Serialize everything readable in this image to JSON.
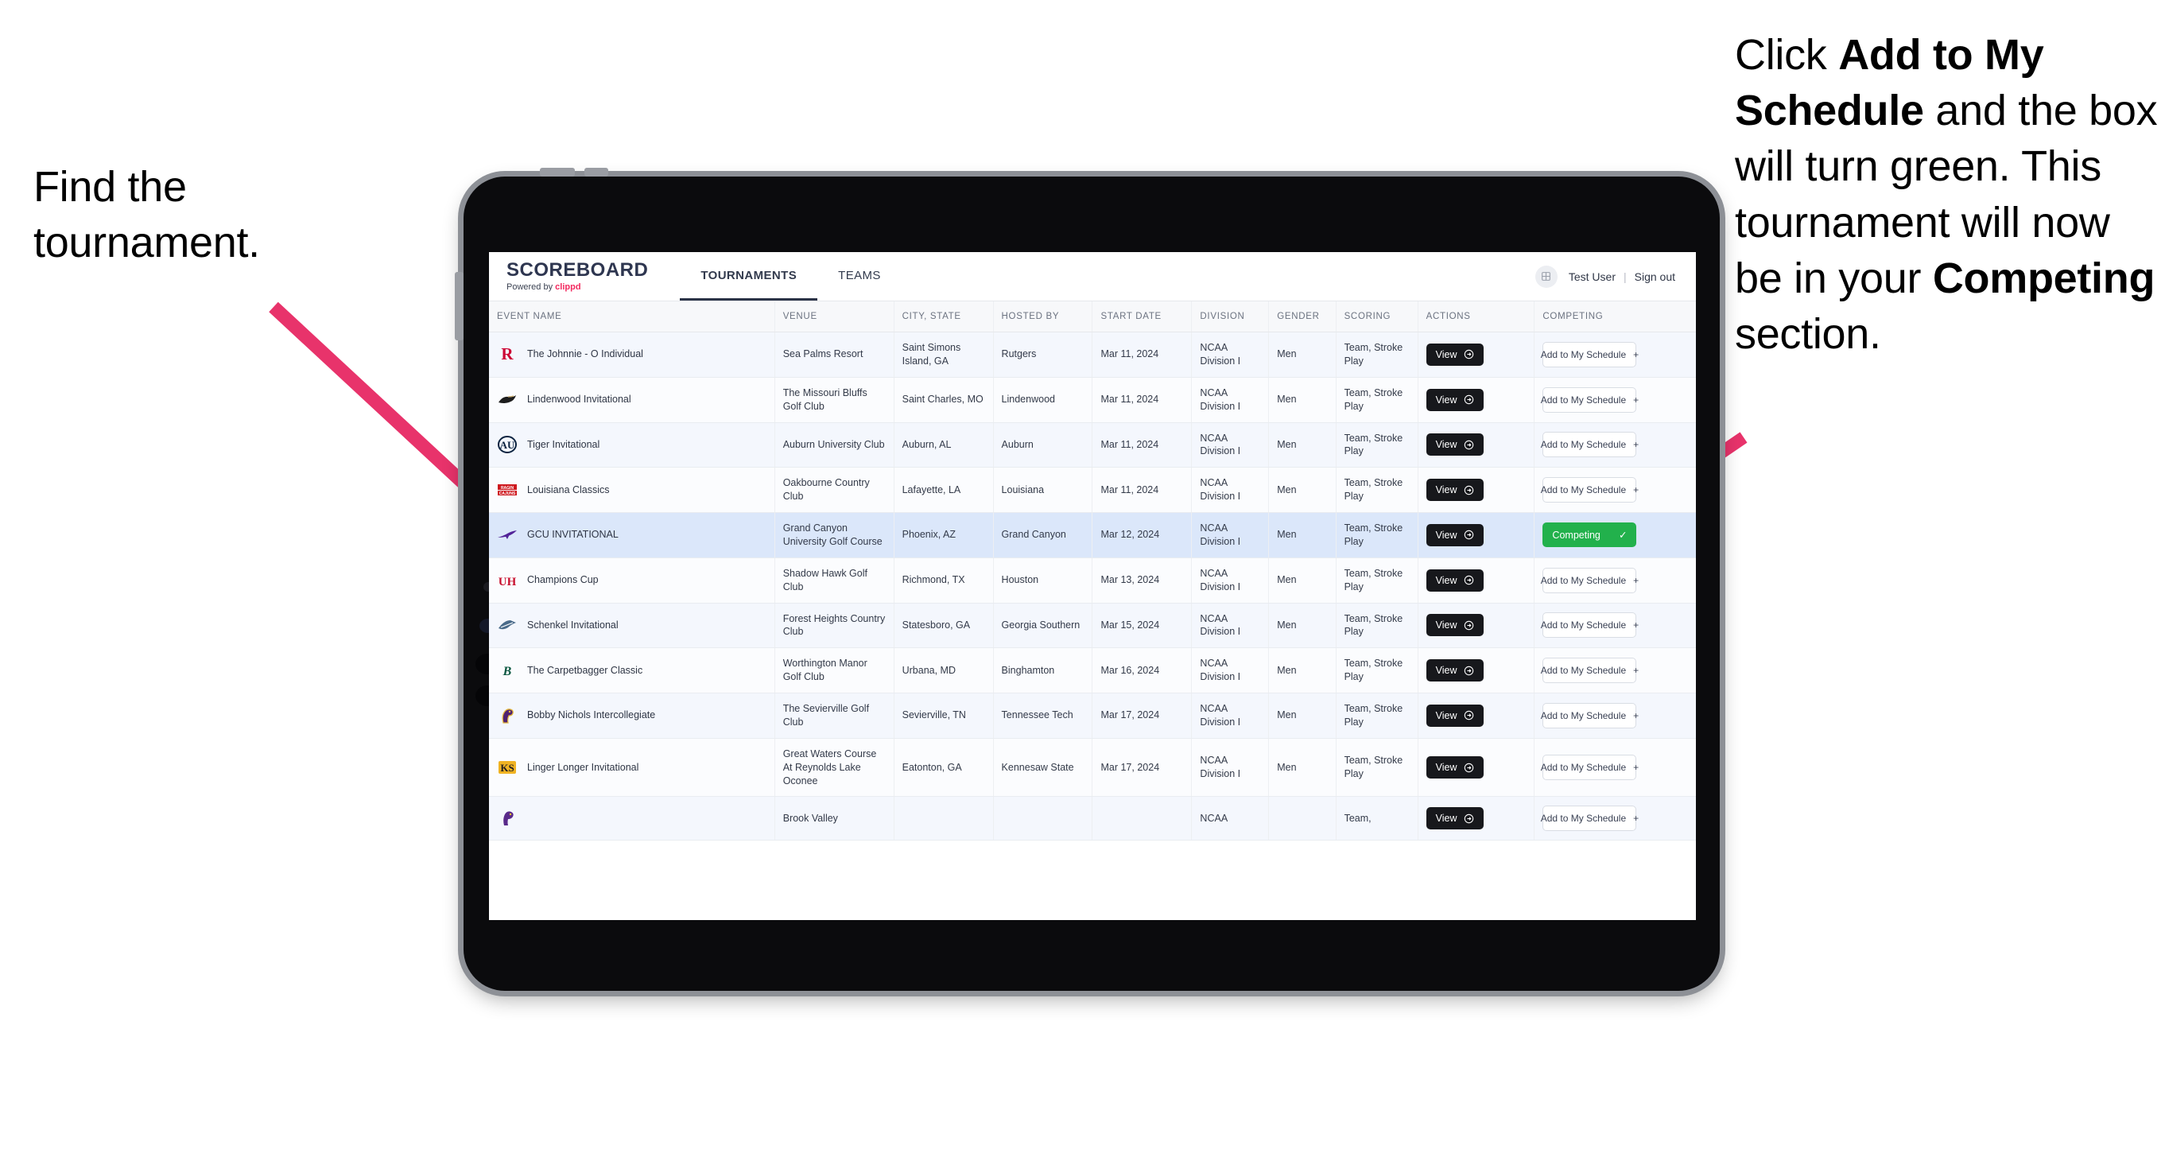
{
  "annotations": {
    "left": {
      "line1": "Find the",
      "line2": "tournament."
    },
    "right": {
      "seg1": "Click ",
      "bold1": "Add to My Schedule",
      "seg2": " and the box will turn green. This tournament will now be in your ",
      "bold2": "Competing",
      "seg3": " section."
    },
    "arrow_color": "#e8336b"
  },
  "app": {
    "brand": {
      "title": "SCOREBOARD",
      "powered_prefix": "Powered by ",
      "powered_name": "clippd"
    },
    "tabs": [
      {
        "label": "TOURNAMENTS",
        "active": true
      },
      {
        "label": "TEAMS",
        "active": false
      }
    ],
    "user": {
      "name": "Test User",
      "separator": "|",
      "sign_out": "Sign out",
      "avatar_icon": "user-avatar-icon"
    }
  },
  "table": {
    "columns": [
      "EVENT NAME",
      "VENUE",
      "CITY, STATE",
      "HOSTED BY",
      "START DATE",
      "DIVISION",
      "GENDER",
      "SCORING",
      "ACTIONS",
      "COMPETING"
    ],
    "labels": {
      "view": "View",
      "add": "Add to My Schedule",
      "competing": "Competing",
      "add_plus": "+",
      "competing_check": "✓"
    },
    "rows": [
      {
        "logo": "rutgers-logo",
        "event": "The Johnnie - O Individual",
        "venue": "Sea Palms Resort",
        "city": "Saint Simons Island, GA",
        "host": "Rutgers",
        "date": "Mar 11, 2024",
        "division": "NCAA Division I",
        "gender": "Men",
        "scoring": "Team, Stroke Play",
        "state": "add"
      },
      {
        "logo": "lindenwood-logo",
        "event": "Lindenwood Invitational",
        "venue": "The Missouri Bluffs Golf Club",
        "city": "Saint Charles, MO",
        "host": "Lindenwood",
        "date": "Mar 11, 2024",
        "division": "NCAA Division I",
        "gender": "Men",
        "scoring": "Team, Stroke Play",
        "state": "add"
      },
      {
        "logo": "auburn-logo",
        "event": "Tiger Invitational",
        "venue": "Auburn University Club",
        "city": "Auburn, AL",
        "host": "Auburn",
        "date": "Mar 11, 2024",
        "division": "NCAA Division I",
        "gender": "Men",
        "scoring": "Team, Stroke Play",
        "state": "add"
      },
      {
        "logo": "louisiana-logo",
        "event": "Louisiana Classics",
        "venue": "Oakbourne Country Club",
        "city": "Lafayette, LA",
        "host": "Louisiana",
        "date": "Mar 11, 2024",
        "division": "NCAA Division I",
        "gender": "Men",
        "scoring": "Team, Stroke Play",
        "state": "add"
      },
      {
        "logo": "gcu-logo",
        "event": "GCU INVITATIONAL",
        "venue": "Grand Canyon University Golf Course",
        "city": "Phoenix, AZ",
        "host": "Grand Canyon",
        "date": "Mar 12, 2024",
        "division": "NCAA Division I",
        "gender": "Men",
        "scoring": "Team, Stroke Play",
        "state": "competing",
        "highlight": true
      },
      {
        "logo": "houston-logo",
        "event": "Champions Cup",
        "venue": "Shadow Hawk Golf Club",
        "city": "Richmond, TX",
        "host": "Houston",
        "date": "Mar 13, 2024",
        "division": "NCAA Division I",
        "gender": "Men",
        "scoring": "Team, Stroke Play",
        "state": "add"
      },
      {
        "logo": "georgia-southern-logo",
        "event": "Schenkel Invitational",
        "venue": "Forest Heights Country Club",
        "city": "Statesboro, GA",
        "host": "Georgia Southern",
        "date": "Mar 15, 2024",
        "division": "NCAA Division I",
        "gender": "Men",
        "scoring": "Team, Stroke Play",
        "state": "add"
      },
      {
        "logo": "binghamton-logo",
        "event": "The Carpetbagger Classic",
        "venue": "Worthington Manor Golf Club",
        "city": "Urbana, MD",
        "host": "Binghamton",
        "date": "Mar 16, 2024",
        "division": "NCAA Division I",
        "gender": "Men",
        "scoring": "Team, Stroke Play",
        "state": "add"
      },
      {
        "logo": "tennessee-tech-logo",
        "event": "Bobby Nichols Intercollegiate",
        "venue": "The Sevierville Golf Club",
        "city": "Sevierville, TN",
        "host": "Tennessee Tech",
        "date": "Mar 17, 2024",
        "division": "NCAA Division I",
        "gender": "Men",
        "scoring": "Team, Stroke Play",
        "state": "add"
      },
      {
        "logo": "kennesaw-logo",
        "event": "Linger Longer Invitational",
        "venue": "Great Waters Course At Reynolds Lake Oconee",
        "city": "Eatonton, GA",
        "host": "Kennesaw State",
        "date": "Mar 17, 2024",
        "division": "NCAA Division I",
        "gender": "Men",
        "scoring": "Team, Stroke Play",
        "state": "add"
      },
      {
        "logo": "ecu-logo",
        "event": "",
        "venue": "Brook Valley",
        "city": "",
        "host": "",
        "date": "",
        "division": "NCAA",
        "gender": "",
        "scoring": "Team,",
        "state": "add",
        "partial": true
      }
    ]
  }
}
